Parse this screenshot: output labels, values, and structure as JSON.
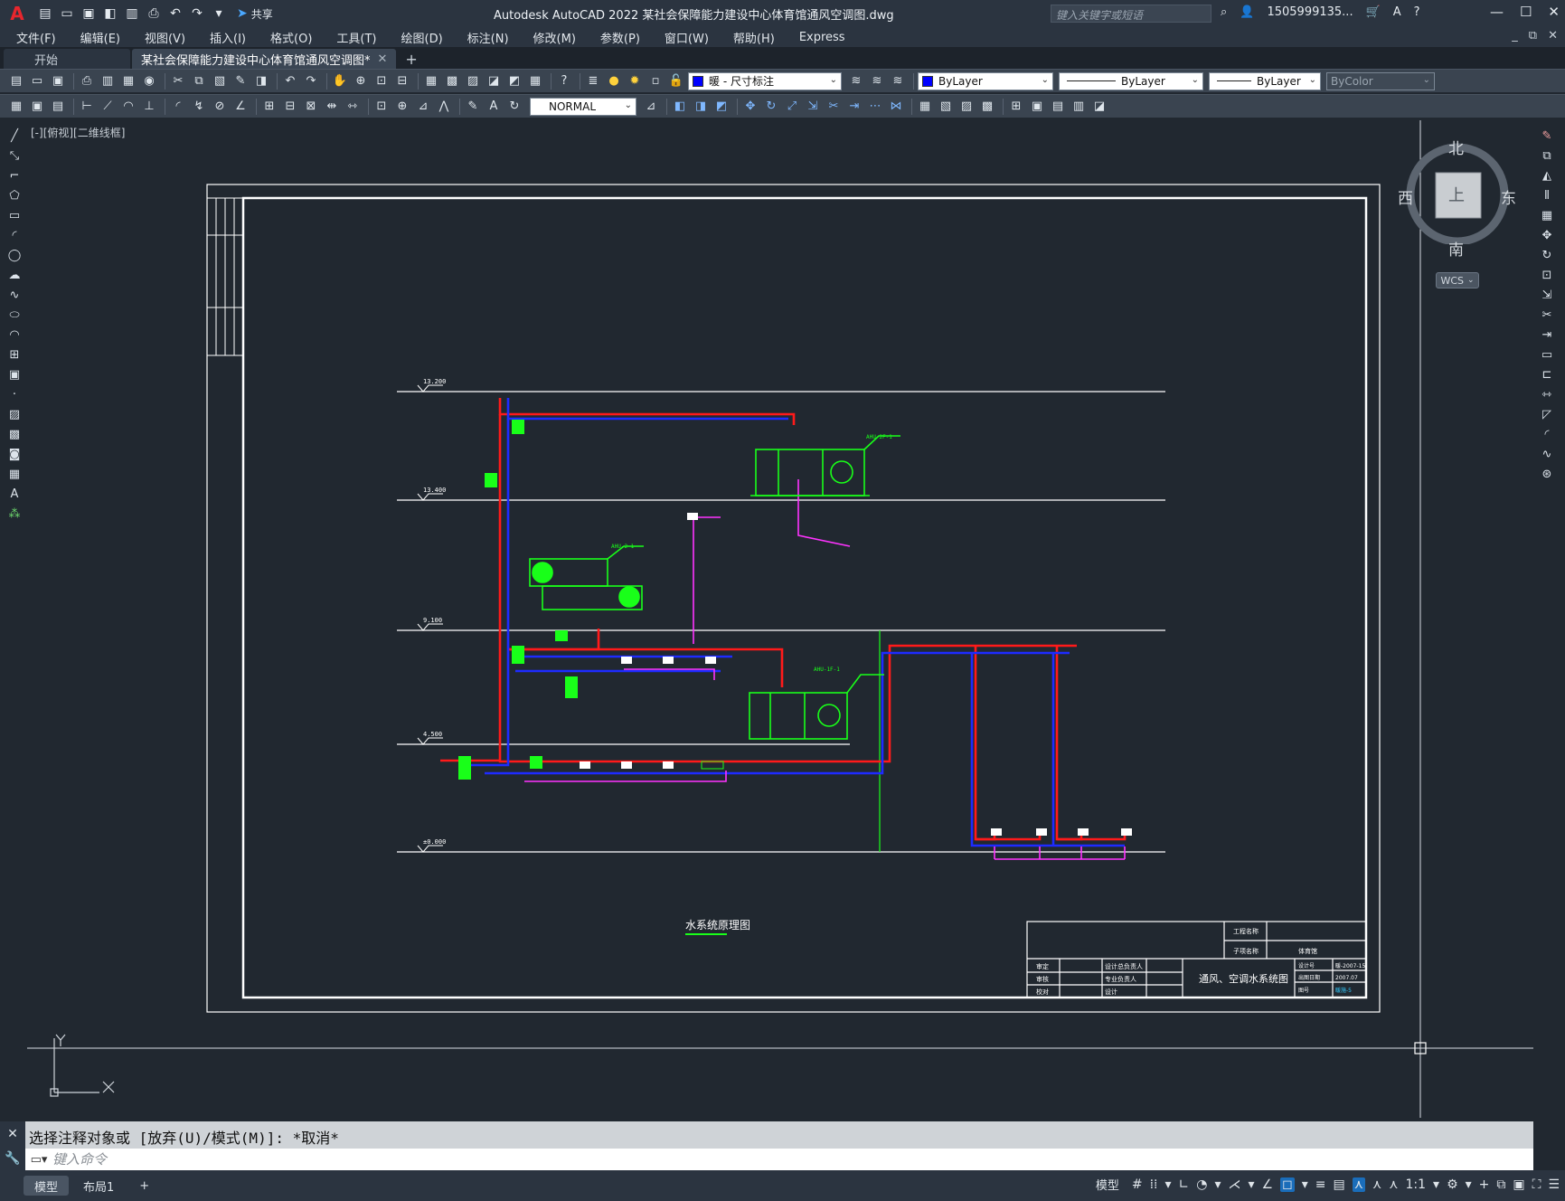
{
  "app": {
    "logo": "A",
    "title": "Autodesk AutoCAD 2022    某社会保障能力建设中心体育馆通风空调图.dwg",
    "share_label": "共享",
    "search_placeholder": "键入关键字或短语",
    "user_name": "1505999135..."
  },
  "menu": [
    "文件(F)",
    "编辑(E)",
    "视图(V)",
    "插入(I)",
    "格式(O)",
    "工具(T)",
    "绘图(D)",
    "标注(N)",
    "修改(M)",
    "参数(P)",
    "窗口(W)",
    "帮助(H)",
    "Express"
  ],
  "tabs": [
    {
      "label": "开始"
    },
    {
      "label": "某社会保障能力建设中心体育馆通风空调图*"
    }
  ],
  "toolbar": {
    "layer_value": "暖 - 尺寸标注",
    "color_value": "ByLayer",
    "linetype_value": "ByLayer",
    "lineweight_value": "ByLayer",
    "plotstyle_value": "ByColor",
    "dimstyle_value": "NORMAL",
    "colors": {
      "layer_swatch": "#0000ff",
      "color_swatch": "#0000ff"
    }
  },
  "viewport": {
    "label": "[-][俯视][二维线框]"
  },
  "viewcube": {
    "north": "北",
    "south": "南",
    "east": "东",
    "west": "西",
    "face": "上",
    "wcs": "WCS"
  },
  "drawing": {
    "levels": [
      "13.200",
      "13.400",
      "9.100",
      "4.500",
      "±0.000"
    ],
    "caption": "水系统原理图",
    "title_block": {
      "project_label": "工程名称",
      "item_label": "子项名称",
      "item_value": "体育馆",
      "drawing_title": "通风、空调水系统图",
      "rows": [
        "审定",
        "审核",
        "校对"
      ],
      "roles": [
        "设计总负责人",
        "专业负责人",
        "设计"
      ],
      "meta_labels": [
        "设计号",
        "出图日期",
        "图号"
      ],
      "meta_values": [
        "暖-2007-15",
        "2007.07",
        "暖施-5"
      ]
    },
    "units": [
      "AHU-2F-1",
      "AHU-2-1",
      "AHU-1F-1"
    ],
    "colors": {
      "supply": "#ff1a1a",
      "return": "#1e2bff",
      "equipment": "#19ff19",
      "drain": "#ff33ff",
      "frame": "#ffffff"
    }
  },
  "command": {
    "history": "选择注释对象或 [放弃(U)/模式(M)]: *取消*",
    "placeholder": "键入命令"
  },
  "status": {
    "layout_tabs": [
      "模型",
      "布局1"
    ],
    "model_label": "模型",
    "scale": "1:1"
  }
}
